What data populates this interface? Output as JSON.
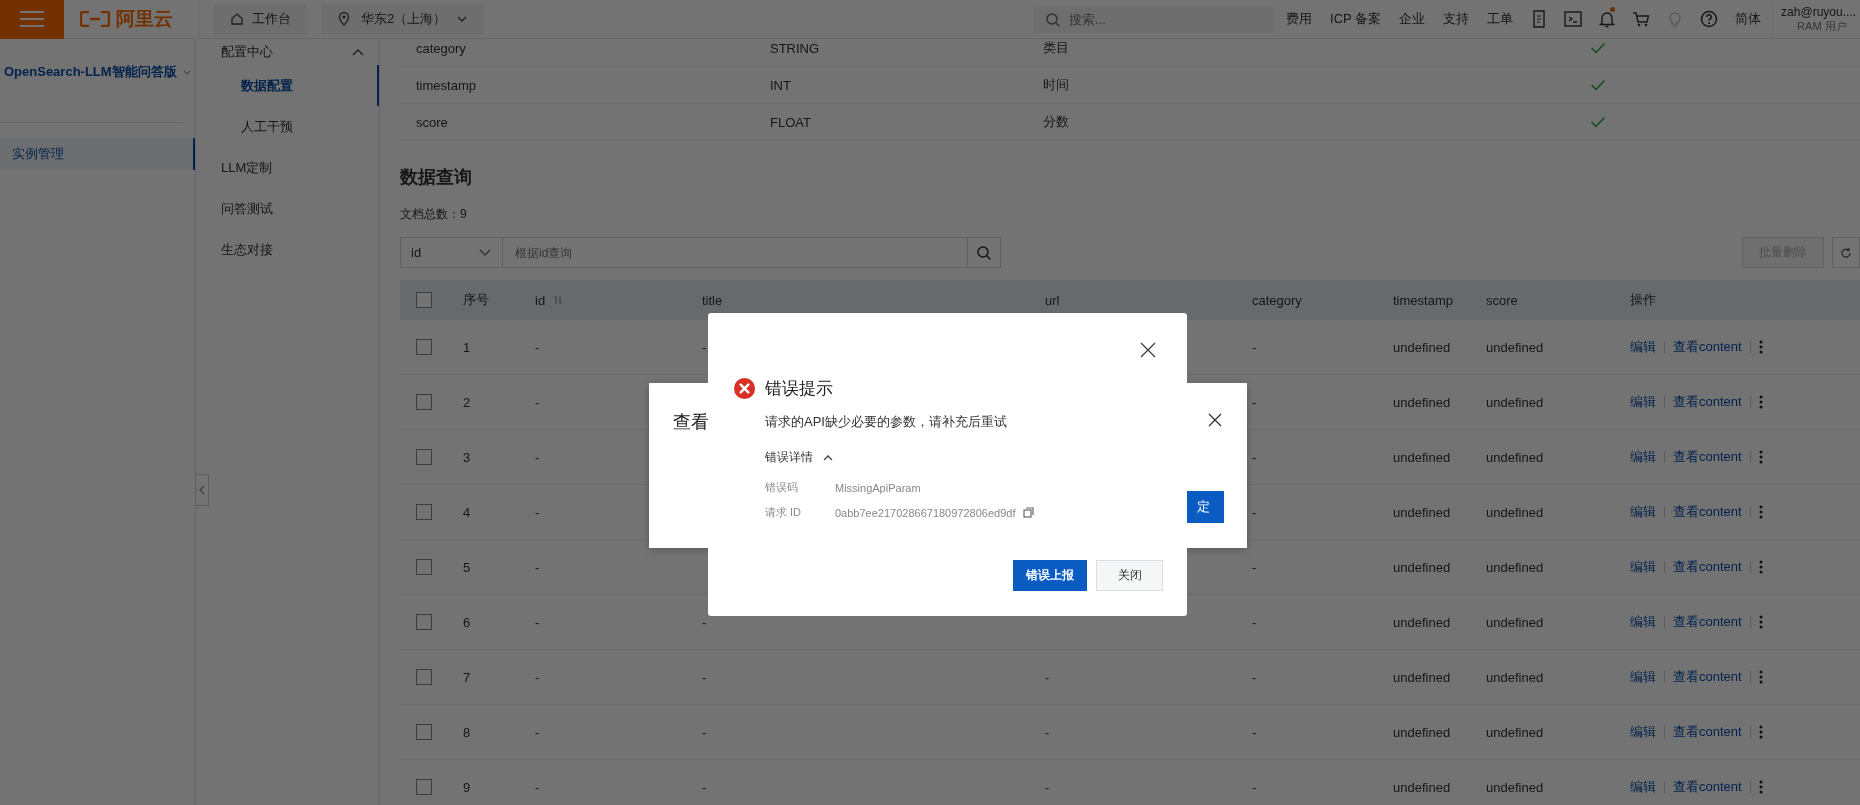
{
  "topbar": {
    "logo": "阿里云",
    "workbench": "工作台",
    "region": "华东2（上海）",
    "search": {
      "placeholder": "搜索..."
    },
    "links": [
      "费用",
      "ICP 备案",
      "企业",
      "支持",
      "工单"
    ],
    "icons": [
      {
        "kind": "api",
        "badge": false,
        "disabled": false
      },
      {
        "kind": "terminal",
        "badge": false,
        "disabled": false
      },
      {
        "kind": "bell",
        "badge": true,
        "disabled": false
      },
      {
        "kind": "cart",
        "badge": false,
        "disabled": false
      },
      {
        "kind": "bulb",
        "badge": false,
        "disabled": true
      },
      {
        "kind": "help",
        "badge": false,
        "disabled": false
      }
    ],
    "language": "简体",
    "user": {
      "name": "zah@ruyou....",
      "role": "RAM 用户"
    }
  },
  "sidebar": {
    "product": "OpenSearch-LLM智能问答版",
    "items": [
      {
        "label": "实例管理",
        "selected": true
      }
    ]
  },
  "subnav": {
    "items": [
      {
        "label": "配置中心",
        "selected": false,
        "expanded": true,
        "children": [
          {
            "label": "数据配置",
            "selected": true
          },
          {
            "label": "人工干预",
            "selected": false
          }
        ]
      },
      {
        "label": "LLM定制",
        "selected": false
      },
      {
        "label": "问答测试",
        "selected": false
      },
      {
        "label": "生态对接",
        "selected": false
      }
    ]
  },
  "schema": {
    "rows": [
      {
        "name": "category",
        "type": "STRING",
        "description": "类目",
        "enabled": true
      },
      {
        "name": "timestamp",
        "type": "INT",
        "description": "时间",
        "enabled": true
      },
      {
        "name": "score",
        "type": "FLOAT",
        "description": "分数",
        "enabled": true
      }
    ]
  },
  "query": {
    "title": "数据查询",
    "count": "文档总数：9",
    "field": "id",
    "placeholder": "根据id查询",
    "batch_delete": {
      "label": "批量删除",
      "disabled": true
    }
  },
  "table": {
    "all_checked": false,
    "columns": [
      {
        "label": "序号",
        "sortable": false
      },
      {
        "label": "id",
        "sortable": true
      },
      {
        "label": "title",
        "sortable": false
      },
      {
        "label": "url",
        "sortable": false
      },
      {
        "label": "category",
        "sortable": false
      },
      {
        "label": "timestamp",
        "sortable": false
      },
      {
        "label": "score",
        "sortable": false
      },
      {
        "label": "操作",
        "sortable": false
      }
    ],
    "rows": [
      {
        "checked": false,
        "no": "1",
        "id": "-",
        "title": "-",
        "category": "-",
        "timestamp": "undefined",
        "score": "undefined",
        "actions": [
          "编辑",
          "查看content"
        ]
      },
      {
        "checked": false,
        "no": "2",
        "id": "-",
        "category": "-",
        "timestamp": "undefined",
        "score": "undefined",
        "actions": [
          "编辑",
          "查看content"
        ]
      },
      {
        "checked": false,
        "no": "3",
        "id": "-",
        "category": "-",
        "timestamp": "undefined",
        "score": "undefined",
        "actions": [
          "编辑",
          "查看content"
        ]
      },
      {
        "checked": false,
        "no": "4",
        "id": "-",
        "category": "-",
        "timestamp": "undefined",
        "score": "undefined",
        "actions": [
          "编辑",
          "查看content"
        ]
      },
      {
        "checked": false,
        "no": "5",
        "id": "-",
        "category": "-",
        "timestamp": "undefined",
        "score": "undefined",
        "actions": [
          "编辑",
          "查看content"
        ]
      },
      {
        "checked": false,
        "no": "6",
        "id": "-",
        "title": "-",
        "category": "-",
        "timestamp": "undefined",
        "score": "undefined",
        "actions": [
          "编辑",
          "查看content"
        ]
      },
      {
        "checked": false,
        "no": "7",
        "id": "-",
        "title": "-",
        "url": "-",
        "category": "-",
        "timestamp": "undefined",
        "score": "undefined",
        "actions": [
          "编辑",
          "查看content"
        ]
      },
      {
        "checked": false,
        "no": "8",
        "id": "-",
        "title": "-",
        "url": "-",
        "category": "-",
        "timestamp": "undefined",
        "score": "undefined",
        "actions": [
          "编辑",
          "查看content"
        ]
      },
      {
        "checked": false,
        "no": "9",
        "id": "-",
        "title": "-",
        "url": "-",
        "category": "-",
        "timestamp": "undefined",
        "score": "undefined",
        "actions": [
          "编辑",
          "查看content"
        ]
      }
    ]
  },
  "back_dialog": {
    "title": "查看",
    "ok": "定"
  },
  "error_dialog": {
    "title": "错误提示",
    "message": "请求的API缺少必要的参数，请补充后重试",
    "details_label": "错误详情",
    "details_expanded": true,
    "details": [
      {
        "label": "错误码",
        "value": "MissingApiParam",
        "copyable": false
      },
      {
        "label": "请求 ID",
        "value": "0abb7ee217028667180972806ed9df",
        "copyable": true
      }
    ],
    "buttons": [
      {
        "label": "错误上报",
        "kind": "primary"
      },
      {
        "label": "关闭",
        "kind": "secondary"
      }
    ]
  }
}
